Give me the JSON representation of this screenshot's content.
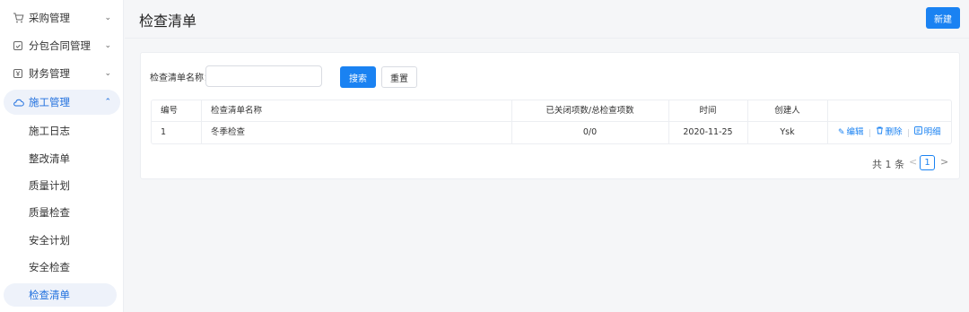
{
  "sidebar": {
    "menus": [
      {
        "label": "采购管理",
        "icon": "cart-icon"
      },
      {
        "label": "分包合同管理",
        "icon": "contract-icon"
      },
      {
        "label": "财务管理",
        "icon": "finance-icon"
      },
      {
        "label": "施工管理",
        "icon": "cloud-icon"
      }
    ],
    "sub_items": [
      {
        "label": "施工日志"
      },
      {
        "label": "整改清单"
      },
      {
        "label": "质量计划"
      },
      {
        "label": "质量检查"
      },
      {
        "label": "安全计划"
      },
      {
        "label": "安全检查"
      },
      {
        "label": "检查清单"
      }
    ]
  },
  "header": {
    "title": "检查清单",
    "new_button": "新建"
  },
  "search": {
    "label": "检查清单名称：",
    "input_value": "",
    "search_button": "搜索",
    "reset_button": "重置"
  },
  "table": {
    "columns": [
      "编号",
      "检查清单名称",
      "已关闭项数/总检查项数",
      "时间",
      "创建人"
    ],
    "rows": [
      {
        "id": "1",
        "name": "冬季检查",
        "ratio": "0/0",
        "time": "2020-11-25",
        "creator": "Ysk"
      }
    ],
    "actions": {
      "edit": "编辑",
      "delete": "删除",
      "detail": "明细"
    }
  },
  "pagination": {
    "total": "共 1 条",
    "current": "1",
    "prev": "<",
    "next": ">"
  },
  "colors": {
    "accent": "#1a82f2",
    "active_bg": "#eef2fa",
    "active_text": "#1f6fde"
  }
}
